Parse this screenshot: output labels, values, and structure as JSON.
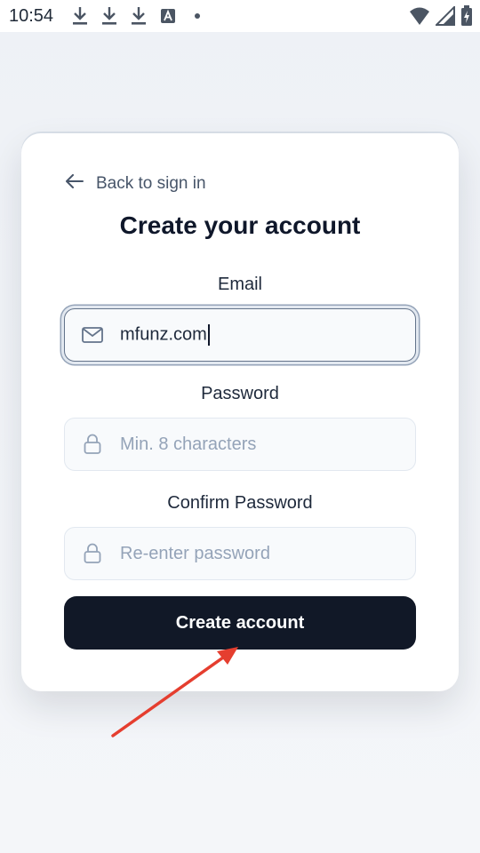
{
  "status_bar": {
    "time": "10:54",
    "icons": [
      "download-icon",
      "download-icon",
      "download-icon",
      "a-box-icon",
      "dot-icon"
    ],
    "right_icons": [
      "wifi-icon",
      "signal-icon",
      "battery-charging-icon"
    ]
  },
  "card": {
    "back_label": "Back to sign in",
    "title": "Create your account",
    "email": {
      "label": "Email",
      "value": "mfunz.com",
      "icon": "mail-icon"
    },
    "password": {
      "label": "Password",
      "placeholder": "Min. 8 characters",
      "icon": "lock-icon"
    },
    "confirm_password": {
      "label": "Confirm Password",
      "placeholder": "Re-enter password",
      "icon": "lock-icon"
    },
    "submit_label": "Create account"
  },
  "colors": {
    "button_bg": "#111827",
    "annotation_arrow": "#e53e2f"
  }
}
